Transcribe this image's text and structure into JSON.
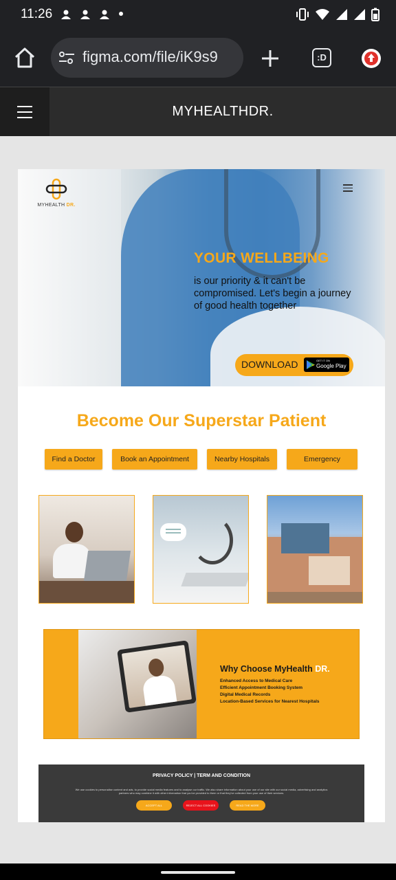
{
  "status_bar": {
    "time": "11:26"
  },
  "browser": {
    "url": "figma.com/file/iK9s9",
    "tabs_label": ":D"
  },
  "prototype": {
    "title": "MYHEALTHDR."
  },
  "site": {
    "logo": {
      "name": "MYHEALTH",
      "accent": "DR."
    },
    "hero": {
      "title": "YOUR WELLBEING",
      "subtitle": "is our priority & it can't be compromised. Let's begin a journey of good health together",
      "download_label": "DOWNLOAD",
      "store_small": "GET IT ON",
      "store_big": "Google Play"
    },
    "section_title": "Become Our Superstar Patient",
    "actions": [
      "Find a Doctor",
      "Book an Appointment",
      "Nearby Hospitals",
      "Emergency"
    ],
    "why": {
      "title": "Why Choose MyHealth",
      "title_accent": "DR.",
      "items": [
        "Enhanced Access to Medical Care",
        "Efficient Appointment Booking System",
        "Digital Medical Records",
        "Location-Based Services for Nearest Hospitals"
      ]
    },
    "cookie": {
      "title": "PRIVACY POLICY | TERM AND  CONDITION",
      "text": "We use cookies to personalise content and ads, to provide social media features and to analyse our traffic. We also share information about your use of our site with our social media, advertising and analytics partners who may combine it with other information that you've provided to them or that they've collected from your use of their services.",
      "accept": "ACCEPT ALL",
      "reject": "REJECT ALL COOKIES",
      "read_more": "READ THE MORE"
    }
  },
  "colors": {
    "accent": "#f6a81a",
    "reject": "#e8131b",
    "footer": "#3a3a3a"
  }
}
